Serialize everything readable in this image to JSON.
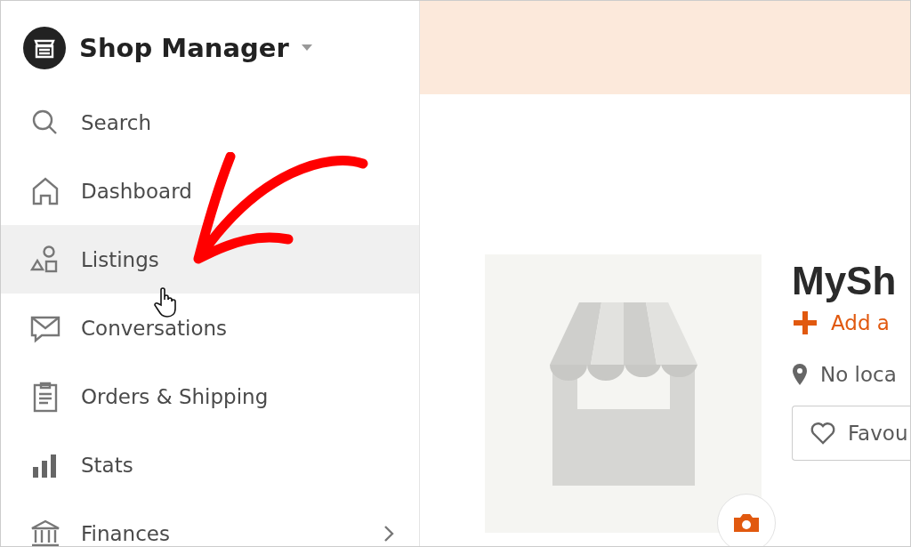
{
  "sidebar": {
    "title": "Shop Manager",
    "items": [
      {
        "kind": "search",
        "label": "Search",
        "selected": false,
        "chevron": false
      },
      {
        "kind": "home",
        "label": "Dashboard",
        "selected": false,
        "chevron": false
      },
      {
        "kind": "shapes",
        "label": "Listings",
        "selected": true,
        "chevron": false
      },
      {
        "kind": "message",
        "label": "Conversations",
        "selected": false,
        "chevron": false
      },
      {
        "kind": "clipboard",
        "label": "Orders & Shipping",
        "selected": false,
        "chevron": false
      },
      {
        "kind": "stats",
        "label": "Stats",
        "selected": false,
        "chevron": false
      },
      {
        "kind": "bank",
        "label": "Finances",
        "selected": false,
        "chevron": true
      }
    ]
  },
  "shop": {
    "name": "MySh",
    "add_link": "Add a",
    "location": "No loca",
    "favourite_button": "Favou"
  }
}
